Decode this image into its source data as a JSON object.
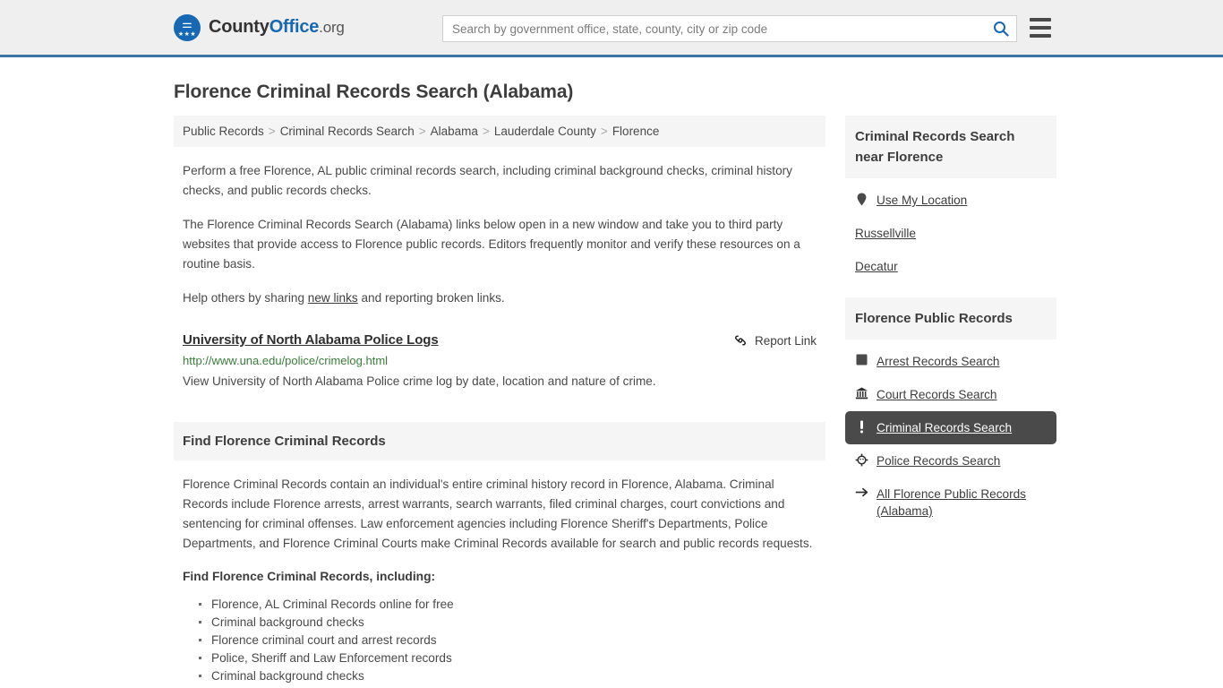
{
  "header": {
    "logo": {
      "part1": "County",
      "part2": "Office",
      "suffix": ".org",
      "icon": "eagle-seal-icon"
    },
    "search": {
      "placeholder": "Search by government office, state, county, city or zip code",
      "value": "",
      "icon": "search-icon"
    },
    "menu": {
      "icon": "hamburger-menu-icon",
      "label": "Menu"
    },
    "accent_color": "#3d72a4"
  },
  "page": {
    "title": "Florence Criminal Records Search (Alabama)"
  },
  "breadcrumb": {
    "separator": ">",
    "items": [
      {
        "label": "Public Records",
        "current": false
      },
      {
        "label": "Criminal Records Search",
        "current": false
      },
      {
        "label": "Alabama",
        "current": false
      },
      {
        "label": "Lauderdale County",
        "current": false
      },
      {
        "label": "Florence",
        "current": true
      }
    ]
  },
  "intro": {
    "paragraph1": "Perform a free Florence, AL public criminal records search, including criminal background checks, criminal history checks, and public records checks.",
    "paragraph2": "The Florence Criminal Records Search (Alabama) links below open in a new window and take you to third party websites that provide access to Florence public records. Editors frequently monitor and verify these resources on a routine basis.",
    "paragraph3_pre": "Help others by sharing ",
    "paragraph3_link": "new links",
    "paragraph3_post": " and reporting broken links."
  },
  "result": {
    "title": "University of North Alabama Police Logs",
    "url": "http://www.una.edu/police/crimelog.html",
    "description": "View University of North Alabama Police crime log by date, location and nature of crime.",
    "report_label": "Report Link",
    "report_icon": "broken-link-icon",
    "url_color": "#3b7d3b"
  },
  "section": {
    "heading": "Find Florence Criminal Records",
    "body": "Florence Criminal Records contain an individual's entire criminal history record in Florence, Alabama. Criminal Records include Florence arrests, arrest warrants, search warrants, filed criminal charges, court convictions and sentencing for criminal offenses. Law enforcement agencies including Florence Sheriff's Departments, Police Departments, and Florence Criminal Courts make Criminal Records available for search and public records requests.",
    "subheading": "Find Florence Criminal Records, including:",
    "bullets": [
      "Florence, AL Criminal Records online for free",
      "Criminal background checks",
      "Florence criminal court and arrest records",
      "Police, Sheriff and Law Enforcement records",
      "Criminal background checks"
    ]
  },
  "sidebar": {
    "near_panel": {
      "heading": "Criminal Records Search near Florence",
      "items": [
        {
          "label": "Use My Location",
          "icon": "map-pin-icon",
          "active": false
        },
        {
          "label": "Russellville",
          "icon": "",
          "active": false
        },
        {
          "label": "Decatur",
          "icon": "",
          "active": false
        }
      ]
    },
    "records_panel": {
      "heading": "Florence Public Records",
      "active_color": "#4a4a4a",
      "items": [
        {
          "label": "Arrest Records Search",
          "icon": "fingerprint-square-icon",
          "active": false
        },
        {
          "label": "Court Records Search",
          "icon": "courthouse-icon",
          "active": false
        },
        {
          "label": "Criminal Records Search",
          "icon": "exclamation-icon",
          "active": true
        },
        {
          "label": "Police Records Search",
          "icon": "police-badge-icon",
          "active": false
        },
        {
          "label": "All Florence Public Records (Alabama)",
          "icon": "arrow-right-icon",
          "active": false
        }
      ]
    }
  }
}
